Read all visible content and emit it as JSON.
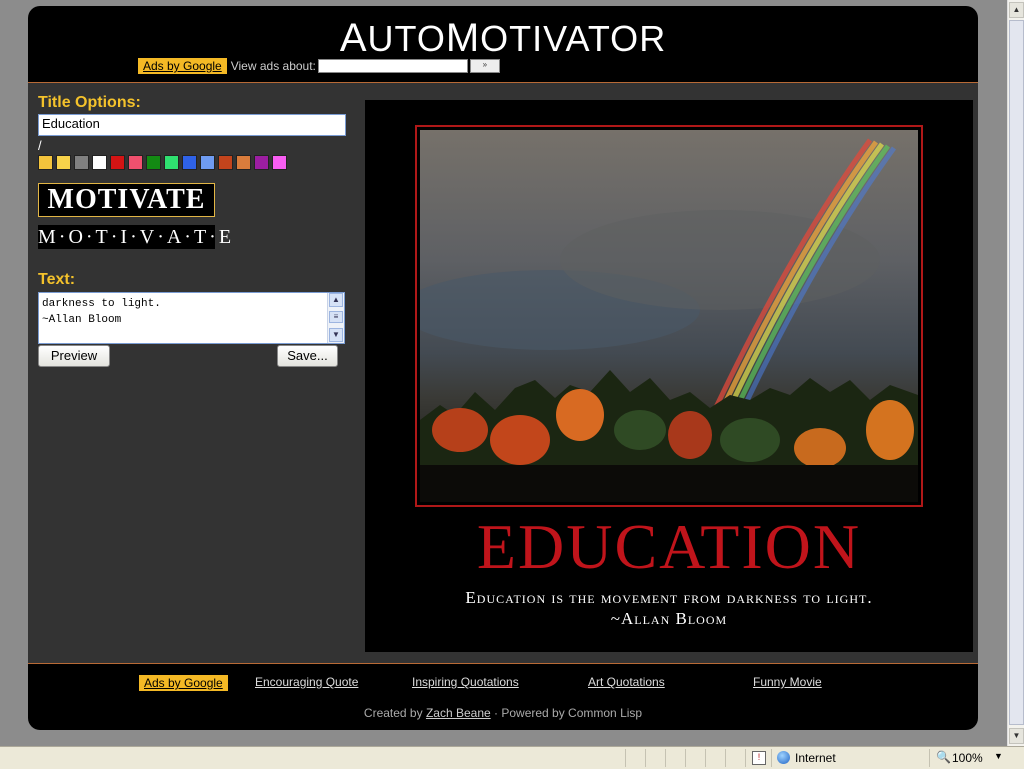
{
  "header": {
    "logo_first_initial": "A",
    "logo_first_rest": "UTO",
    "logo_second_initial": "M",
    "logo_second_rest": "OTIVATOR",
    "ads_badge": "Ads by Google",
    "view_ads_label": "View ads about:",
    "ads_input_value": "",
    "ads_go_label": "»"
  },
  "editor": {
    "title_options_label": "Title Options:",
    "title_value": "Education",
    "slash": "/",
    "swatch_colors": [
      "#f4c43c",
      "#f7d24a",
      "#808080",
      "#ffffff",
      "#d41414",
      "#f0506e",
      "#138a13",
      "#2fe070",
      "#2f62e8",
      "#6f9cf2",
      "#c3441c",
      "#d97c3c",
      "#9c1ea1",
      "#f85ef2"
    ],
    "font_option_1": "MOTIVATE",
    "font_option_2": "M·O·T·I·V·A·T·E",
    "text_label": "Text:",
    "text_value": "darkness to light.\n~Allan Bloom",
    "preview_button": "Preview",
    "save_button": "Save..."
  },
  "poster": {
    "title": "EDUCATION",
    "line1": "Education is the movement from darkness to light.",
    "line2": "~Allan Bloom",
    "title_color": "#c0141b",
    "frame_color": "#b01818"
  },
  "footer": {
    "ads_badge": "Ads by Google",
    "links": [
      "Encouraging Quote",
      "Inspiring Quotations",
      "Art Quotations",
      "Funny Movie"
    ],
    "credit_prefix": "Created by",
    "credit_author": "Zach Beane",
    "credit_suffix": "· Powered by Common Lisp"
  },
  "browser": {
    "zone": "Internet",
    "zoom": "100%"
  }
}
